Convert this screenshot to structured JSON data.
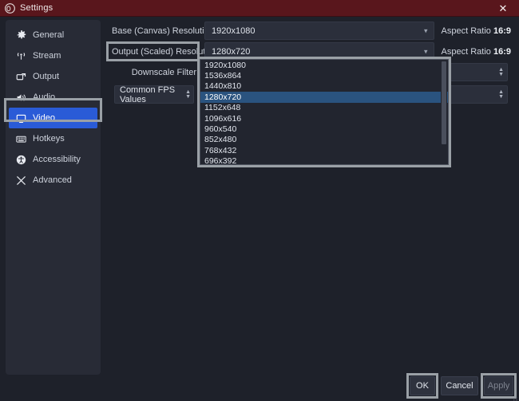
{
  "window": {
    "title": "Settings",
    "icon": "obs-logo-icon",
    "close_label": "✕",
    "titlebar_color": "#59161c"
  },
  "sidebar": {
    "items": [
      {
        "label": "General",
        "icon": "gear-icon",
        "selected": false
      },
      {
        "label": "Stream",
        "icon": "broadcast-icon",
        "selected": false
      },
      {
        "label": "Output",
        "icon": "output-icon",
        "selected": false
      },
      {
        "label": "Audio",
        "icon": "speaker-icon",
        "selected": false
      },
      {
        "label": "Video",
        "icon": "monitor-icon",
        "selected": true
      },
      {
        "label": "Hotkeys",
        "icon": "keyboard-icon",
        "selected": false
      },
      {
        "label": "Accessibility",
        "icon": "accessibility-icon",
        "selected": false
      },
      {
        "label": "Advanced",
        "icon": "tools-icon",
        "selected": false
      }
    ],
    "selected_color": "#2a5bd7"
  },
  "main": {
    "base_resolution": {
      "label": "Base (Canvas) Resolution",
      "value": "1920x1080",
      "aspect_label": "Aspect Ratio",
      "aspect_value": "16:9"
    },
    "output_resolution": {
      "label": "Output (Scaled) Resolution",
      "value": "1280x720",
      "aspect_label": "Aspect Ratio",
      "aspect_value": "16:9",
      "highlighted": true
    },
    "downscale_filter": {
      "label": "Downscale Filter"
    },
    "fps_type": {
      "value": "Common FPS Values"
    }
  },
  "dropdown": {
    "open": true,
    "selected_value": "1280x720",
    "highlight_color": "#2a537f",
    "options": [
      "1920x1080",
      "1536x864",
      "1440x810",
      "1280x720",
      "1152x648",
      "1096x616",
      "960x540",
      "852x480",
      "768x432",
      "696x392"
    ]
  },
  "footer": {
    "ok_label": "OK",
    "cancel_label": "Cancel",
    "apply_label": "Apply",
    "apply_enabled": false
  }
}
